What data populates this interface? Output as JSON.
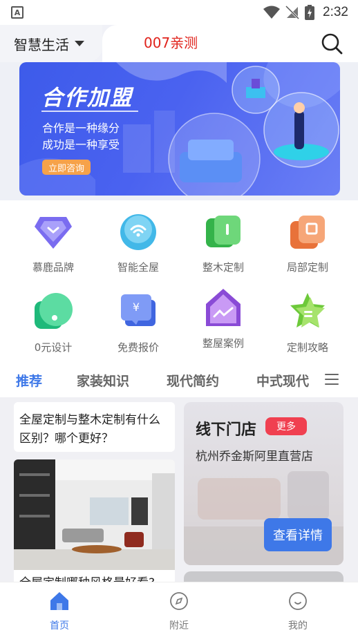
{
  "status_bar": {
    "time": "2:32",
    "left_icon": "A"
  },
  "header": {
    "location": "智慧生活",
    "title": "007亲测"
  },
  "banner": {
    "title": "合作加盟",
    "line1": "合作是一种缘分",
    "line2": "成功是一种享受",
    "button": "立即咨询"
  },
  "grid": {
    "items": [
      {
        "label": "慕鹿品牌",
        "icon": "brand-icon"
      },
      {
        "label": "智能全屋",
        "icon": "wifi-icon"
      },
      {
        "label": "整木定制",
        "icon": "wood-icon"
      },
      {
        "label": "局部定制",
        "icon": "partial-icon"
      },
      {
        "label": "0元设计",
        "icon": "design-icon"
      },
      {
        "label": "免费报价",
        "icon": "quote-icon"
      },
      {
        "label": "整屋案例",
        "icon": "case-icon"
      },
      {
        "label": "定制攻略",
        "icon": "guide-icon"
      }
    ]
  },
  "tabs": {
    "items": [
      {
        "label": "推荐"
      },
      {
        "label": "家装知识"
      },
      {
        "label": "现代简约"
      },
      {
        "label": "中式现代"
      }
    ]
  },
  "feed": {
    "left_title": "全屋定制与整木定制有什么区别？哪个更好？",
    "left_caption": "全屋定制哪种风格最好看?",
    "store_title": "线下门店",
    "store_more": "更多",
    "store_name": "杭州乔金斯阿里直营店",
    "store_button": "查看详情"
  },
  "bottom_nav": {
    "items": [
      {
        "label": "首页"
      },
      {
        "label": "附近"
      },
      {
        "label": "我的"
      }
    ]
  },
  "colors": {
    "accent": "#3e78e8",
    "title_red": "#e0231c",
    "badge_red": "#f04050"
  }
}
